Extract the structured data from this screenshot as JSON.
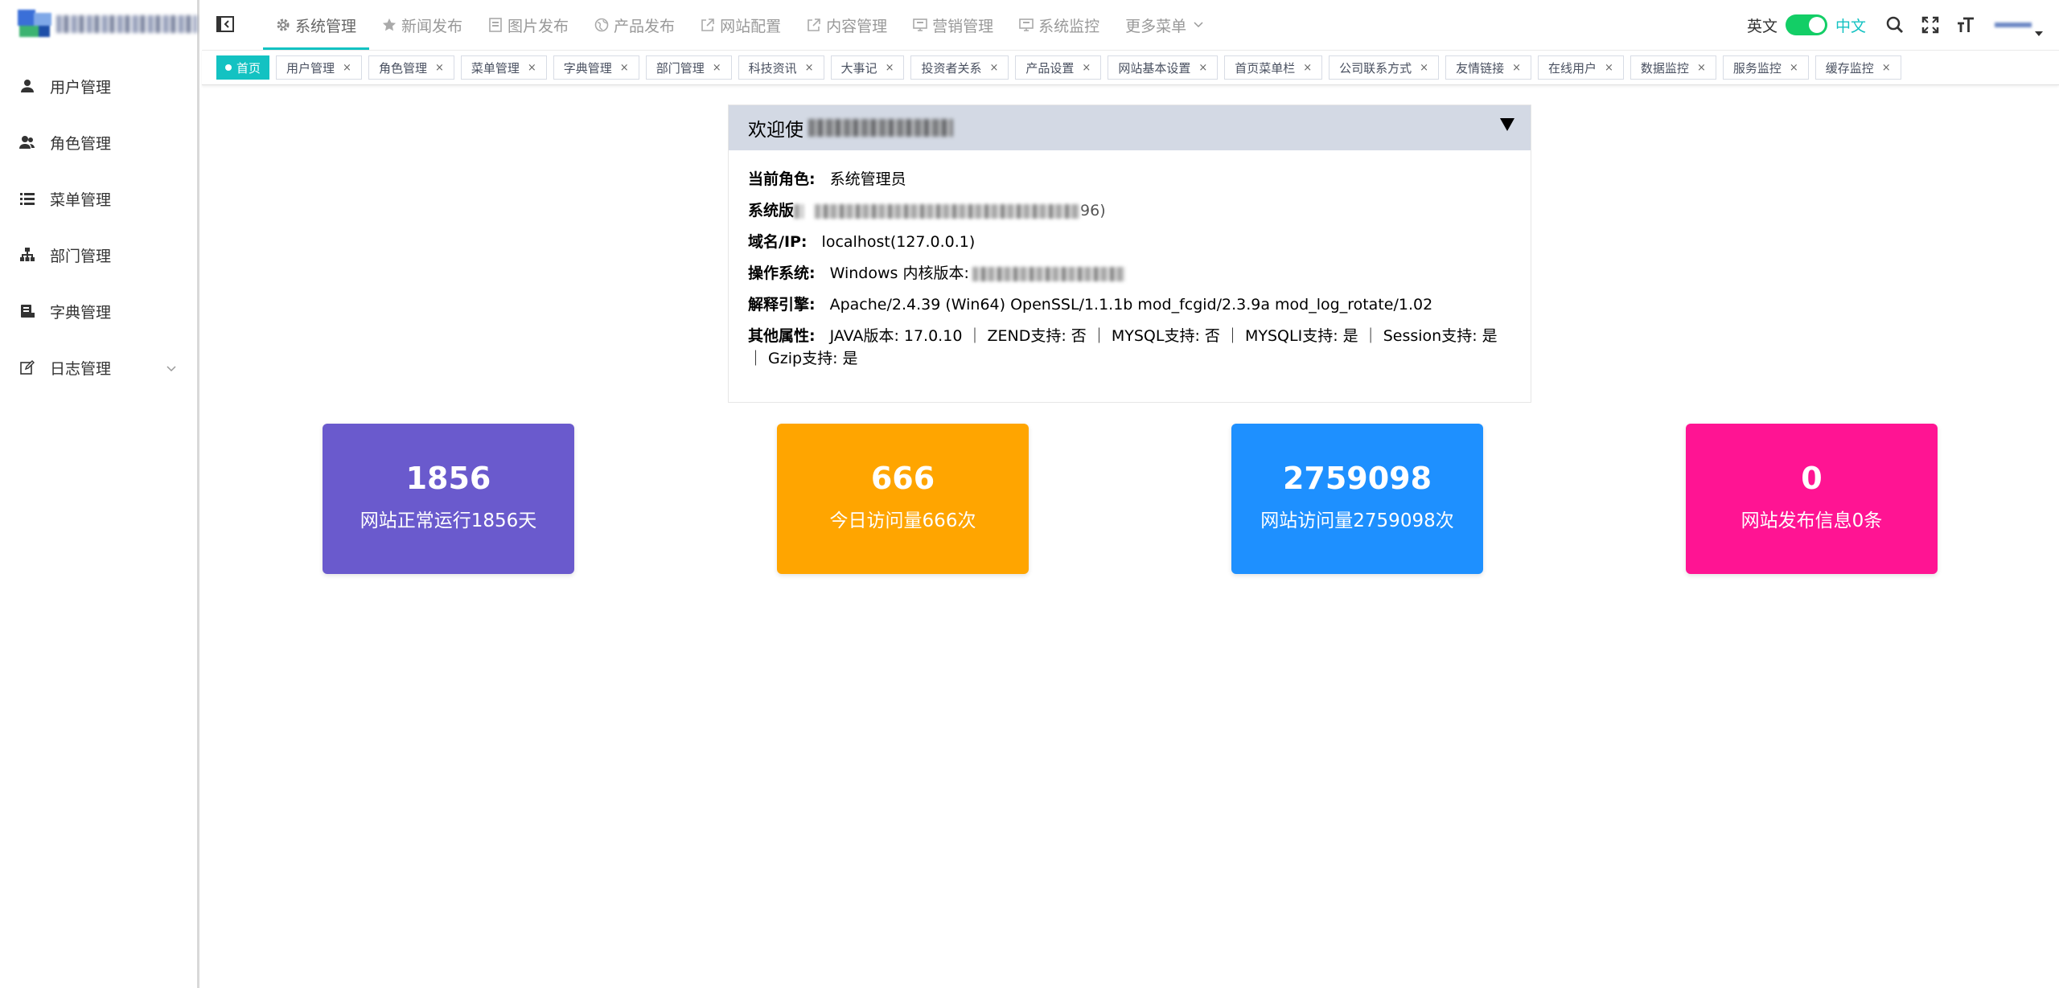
{
  "header": {
    "nav": [
      {
        "label": "系统管理",
        "icon": "gear-icon",
        "active": true
      },
      {
        "label": "新闻发布",
        "icon": "star-icon"
      },
      {
        "label": "图片发布",
        "icon": "image-doc-icon"
      },
      {
        "label": "产品发布",
        "icon": "globe-icon"
      },
      {
        "label": "网站配置",
        "icon": "external-link-icon"
      },
      {
        "label": "内容管理",
        "icon": "external-link-icon"
      },
      {
        "label": "营销管理",
        "icon": "monitor-icon"
      },
      {
        "label": "系统监控",
        "icon": "monitor-icon"
      },
      {
        "label": "更多菜单",
        "icon": "chevron-down-icon"
      }
    ],
    "lang_en": "英文",
    "lang_zh": "中文"
  },
  "sidebar": {
    "items": [
      {
        "label": "用户管理",
        "icon": "user-icon"
      },
      {
        "label": "角色管理",
        "icon": "users-icon"
      },
      {
        "label": "菜单管理",
        "icon": "list-icon"
      },
      {
        "label": "部门管理",
        "icon": "org-chart-icon"
      },
      {
        "label": "字典管理",
        "icon": "dictionary-icon"
      },
      {
        "label": "日志管理",
        "icon": "edit-icon"
      }
    ]
  },
  "tabs": [
    {
      "label": "首页",
      "active": true
    },
    {
      "label": "用户管理"
    },
    {
      "label": "角色管理"
    },
    {
      "label": "菜单管理"
    },
    {
      "label": "字典管理"
    },
    {
      "label": "部门管理"
    },
    {
      "label": "科技资讯"
    },
    {
      "label": "大事记"
    },
    {
      "label": "投资者关系"
    },
    {
      "label": "产品设置"
    },
    {
      "label": "网站基本设置"
    },
    {
      "label": "首页菜单栏"
    },
    {
      "label": "公司联系方式"
    },
    {
      "label": "友情链接"
    },
    {
      "label": "在线用户"
    },
    {
      "label": "数据监控"
    },
    {
      "label": "服务监控"
    },
    {
      "label": "缓存监控"
    }
  ],
  "tab_close": "×",
  "panel": {
    "title": "欢迎使",
    "rows": {
      "role_label": "当前角色:",
      "role_value": "系统管理员",
      "version_label": "系统版",
      "version_tail": "96)",
      "domain_label": "域名/IP:",
      "domain_value": "localhost(127.0.0.1)",
      "os_label": "操作系统:",
      "os_value": "Windows 内核版本:",
      "engine_label": "解释引擎:",
      "engine_value": "Apache/2.4.39 (Win64) OpenSSL/1.1.1b mod_fcgid/2.3.9a mod_log_rotate/1.02",
      "other_label": "其他属性:",
      "other_value": "JAVA版本: 17.0.10 ｜ ZEND支持: 否 ｜ MYSQL支持: 否 ｜ MYSQLI支持: 是 ｜ Session支持: 是 ｜ Gzip支持: 是"
    }
  },
  "cards": [
    {
      "number": "1856",
      "desc": "网站正常运行1856天",
      "color": "#6a5acd"
    },
    {
      "number": "666",
      "desc": "今日访问量666次",
      "color": "#ffa500"
    },
    {
      "number": "2759098",
      "desc": "网站访问量2759098次",
      "color": "#1e90ff"
    },
    {
      "number": "0",
      "desc": "网站发布信息0条",
      "color": "#ff1493"
    }
  ]
}
